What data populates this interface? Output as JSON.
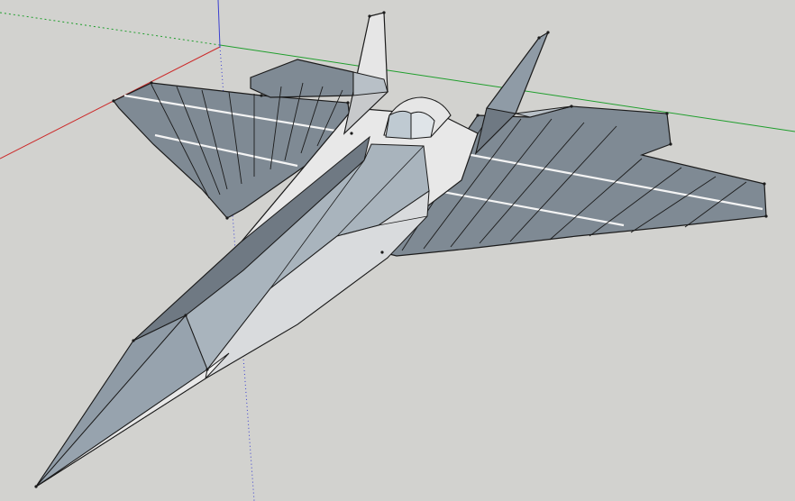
{
  "viewport": {
    "background": "#d2d2cf",
    "axis_colors": {
      "red": "#cc2a2a",
      "green": "#1f9e2c",
      "blue": "#3a3fd0"
    }
  },
  "model": {
    "face_colors": {
      "light": "#e8e8e8",
      "mid": "#c7c9cb",
      "dark": "#8f9ba6",
      "wing": "#7f8a94",
      "edge": "#1b1b1b",
      "highlight": "#f4f4f4"
    },
    "parts": [
      "nose-cone",
      "fuselage",
      "canopy",
      "left-wing",
      "right-wing",
      "left-tail-fin",
      "right-tail-fin",
      "left-stabilizer",
      "right-stabilizer"
    ]
  }
}
